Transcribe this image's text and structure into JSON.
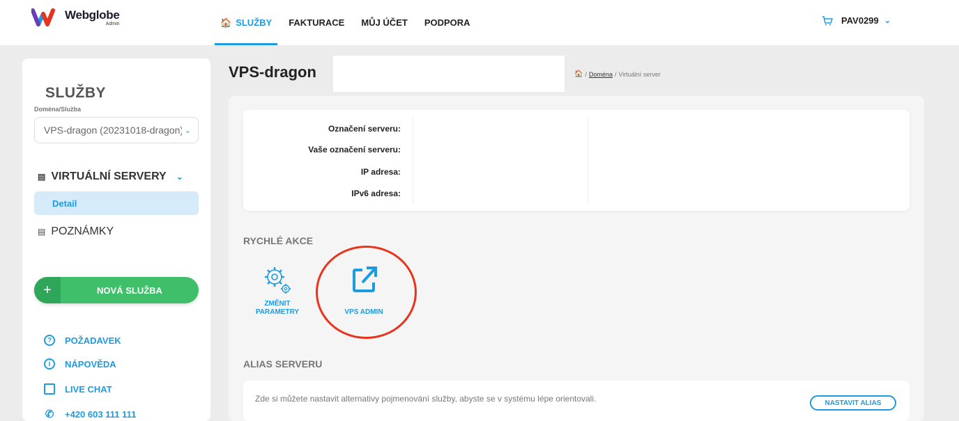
{
  "brand": {
    "name": "Webglobe",
    "sub": "Admin"
  },
  "nav": {
    "items": [
      {
        "label": "SLUŽBY",
        "active": true
      },
      {
        "label": "FAKTURACE"
      },
      {
        "label": "MŮJ ÚČET"
      },
      {
        "label": "PODPORA"
      }
    ],
    "account": "PAV0299"
  },
  "sidebar": {
    "title": "SLUŽBY",
    "select_label": "Doména/Služba",
    "select_value": "VPS-dragon (20231018-dragon)",
    "section": "VIRTUÁLNÍ SERVERY",
    "sub_item": "Detail",
    "notes": "POZNÁMKY",
    "new_service": "NOVÁ SLUŽBA",
    "links": {
      "request": "POŽADAVEK",
      "help": "NÁPOVĚDA",
      "chat": "LIVE CHAT",
      "phone": "+420 603 111 111"
    }
  },
  "header": {
    "title": "VPS-dragon",
    "breadcrumb_link": "Doména",
    "breadcrumb_current": "Virtuální server"
  },
  "info": {
    "server_label": "Označení serveru:",
    "your_label": "Vaše označení serveru:",
    "ip_label": "IP adresa:",
    "ipv6_label": "IPv6 adresa:"
  },
  "quick_actions": {
    "title": "RYCHLÉ AKCE",
    "change_line1": "ZMĚNIT",
    "change_line2": "PARAMETRY",
    "vps_admin": "VPS ADMIN"
  },
  "alias": {
    "title": "ALIAS SERVERU",
    "text": "Zde si můžete nastavit alternativy pojmenování služby, abyste se v systému lépe orientovali.",
    "button": "NASTAVIT ALIAS"
  },
  "colors": {
    "accent": "#1d9be0",
    "green": "#3fbf6a",
    "highlight": "#e8341c"
  }
}
